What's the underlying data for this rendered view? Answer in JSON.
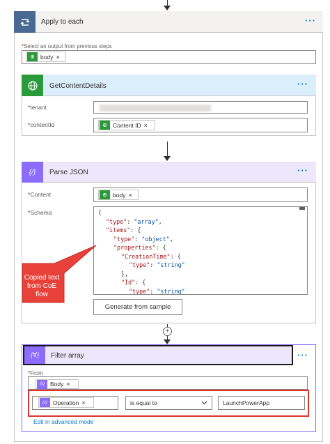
{
  "apply_each": {
    "title": "Apply to each",
    "select_label": "Select an output from previous steps",
    "token": "body"
  },
  "get_content": {
    "title": "GetContentDetails",
    "tenant_label": "tenant",
    "contentid_label": "contentId",
    "contentid_token": "Content ID"
  },
  "parse_json": {
    "title": "Parse JSON",
    "content_label": "Content",
    "content_token": "body",
    "schema_label": "Schema",
    "generate_button": "Generate from sample",
    "schema_lines": [
      {
        "indent": 0,
        "parts": [
          {
            "t": "{",
            "c": "p"
          }
        ]
      },
      {
        "indent": 1,
        "parts": [
          {
            "t": "\"type\"",
            "c": "k"
          },
          {
            "t": ": ",
            "c": "p"
          },
          {
            "t": "\"array\"",
            "c": "v"
          },
          {
            "t": ",",
            "c": "p"
          }
        ]
      },
      {
        "indent": 1,
        "parts": [
          {
            "t": "\"items\"",
            "c": "k"
          },
          {
            "t": ": {",
            "c": "p"
          }
        ]
      },
      {
        "indent": 2,
        "parts": [
          {
            "t": "\"type\"",
            "c": "k"
          },
          {
            "t": ": ",
            "c": "p"
          },
          {
            "t": "\"object\"",
            "c": "v"
          },
          {
            "t": ",",
            "c": "p"
          }
        ]
      },
      {
        "indent": 2,
        "parts": [
          {
            "t": "\"properties\"",
            "c": "k"
          },
          {
            "t": ": {",
            "c": "p"
          }
        ]
      },
      {
        "indent": 3,
        "parts": [
          {
            "t": "\"CreationTime\"",
            "c": "k"
          },
          {
            "t": ": {",
            "c": "p"
          }
        ]
      },
      {
        "indent": 4,
        "parts": [
          {
            "t": "\"type\"",
            "c": "k"
          },
          {
            "t": ": ",
            "c": "p"
          },
          {
            "t": "\"string\"",
            "c": "v"
          }
        ]
      },
      {
        "indent": 3,
        "parts": [
          {
            "t": "},",
            "c": "p"
          }
        ]
      },
      {
        "indent": 3,
        "parts": [
          {
            "t": "\"Id\"",
            "c": "k"
          },
          {
            "t": ": {",
            "c": "p"
          }
        ]
      },
      {
        "indent": 4,
        "parts": [
          {
            "t": "\"type\"",
            "c": "k"
          },
          {
            "t": ": ",
            "c": "p"
          },
          {
            "t": "\"string\"",
            "c": "v"
          }
        ]
      }
    ]
  },
  "callout": {
    "text_line1": "Copied text",
    "text_line2": "from CoE",
    "text_line3": "flow"
  },
  "filter_array": {
    "title": "Filter array",
    "from_label": "From",
    "from_token": "Body",
    "condition_token": "Operation",
    "operator": "is equal to",
    "value": "LaunchPowerApp",
    "advanced_link": "Edit in advanced mode"
  },
  "icons": {
    "loop": "loop-icon",
    "globe": "globe-icon",
    "braces": "braces-icon",
    "filter": "filter-braces-icon",
    "close": "close-icon",
    "chevron": "chevron-down-icon",
    "plus": "plus-icon"
  },
  "colors": {
    "loop": "#486991",
    "connector_green": "#2b9a3b",
    "data_ops_purple": "#8c6cff",
    "accent_blue": "#0078d4",
    "callout_red": "#e8413a",
    "highlight_red": "#d9362f"
  },
  "redacted_tenant": "redacted"
}
